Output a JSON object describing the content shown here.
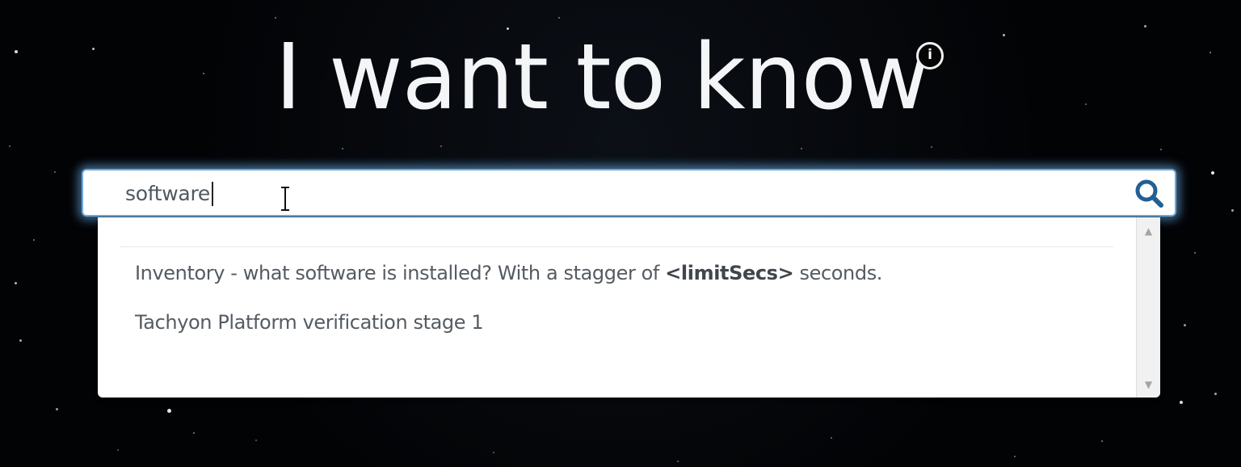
{
  "page": {
    "heading": "I want to know",
    "info_icon": "i"
  },
  "search": {
    "value": "software",
    "placeholder": "",
    "button_icon": "search-icon"
  },
  "suggestions": {
    "item1_prefix": "Inventory - what software is installed? With a stagger of ",
    "item1_param": "<limitSecs>",
    "item1_suffix": " seconds.",
    "item2": "Tachyon Platform verification stage 1"
  },
  "scrollbar": {
    "up_arrow": "▲",
    "down_arrow": "▼"
  },
  "colors": {
    "background": "#020305",
    "glow": "#68ace8",
    "text": "#545b62"
  }
}
